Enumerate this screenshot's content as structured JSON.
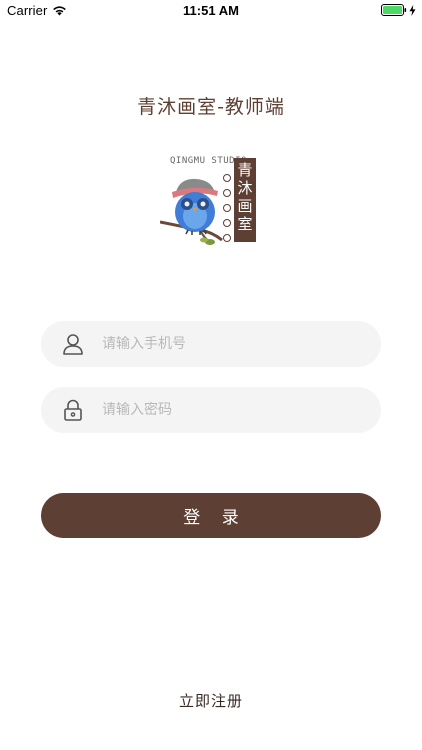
{
  "status_bar": {
    "carrier": "Carrier",
    "time": "11:51 AM",
    "battery_color": "#4cd964"
  },
  "app": {
    "title": "青沐画室-教师端"
  },
  "logo": {
    "caption": "QINGMU STUDIO",
    "banner_chars": [
      "青",
      "沐",
      "画",
      "室"
    ]
  },
  "form": {
    "phone": {
      "icon": "user-icon",
      "placeholder": "请输入手机号",
      "value": ""
    },
    "password": {
      "icon": "lock-icon",
      "placeholder": "请输入密码",
      "value": ""
    }
  },
  "actions": {
    "login_label": "登 录",
    "register_label": "立即注册"
  },
  "colors": {
    "brand": "#5e3f33",
    "input_bg": "#f4f4f4",
    "placeholder": "#b8b8b8"
  }
}
